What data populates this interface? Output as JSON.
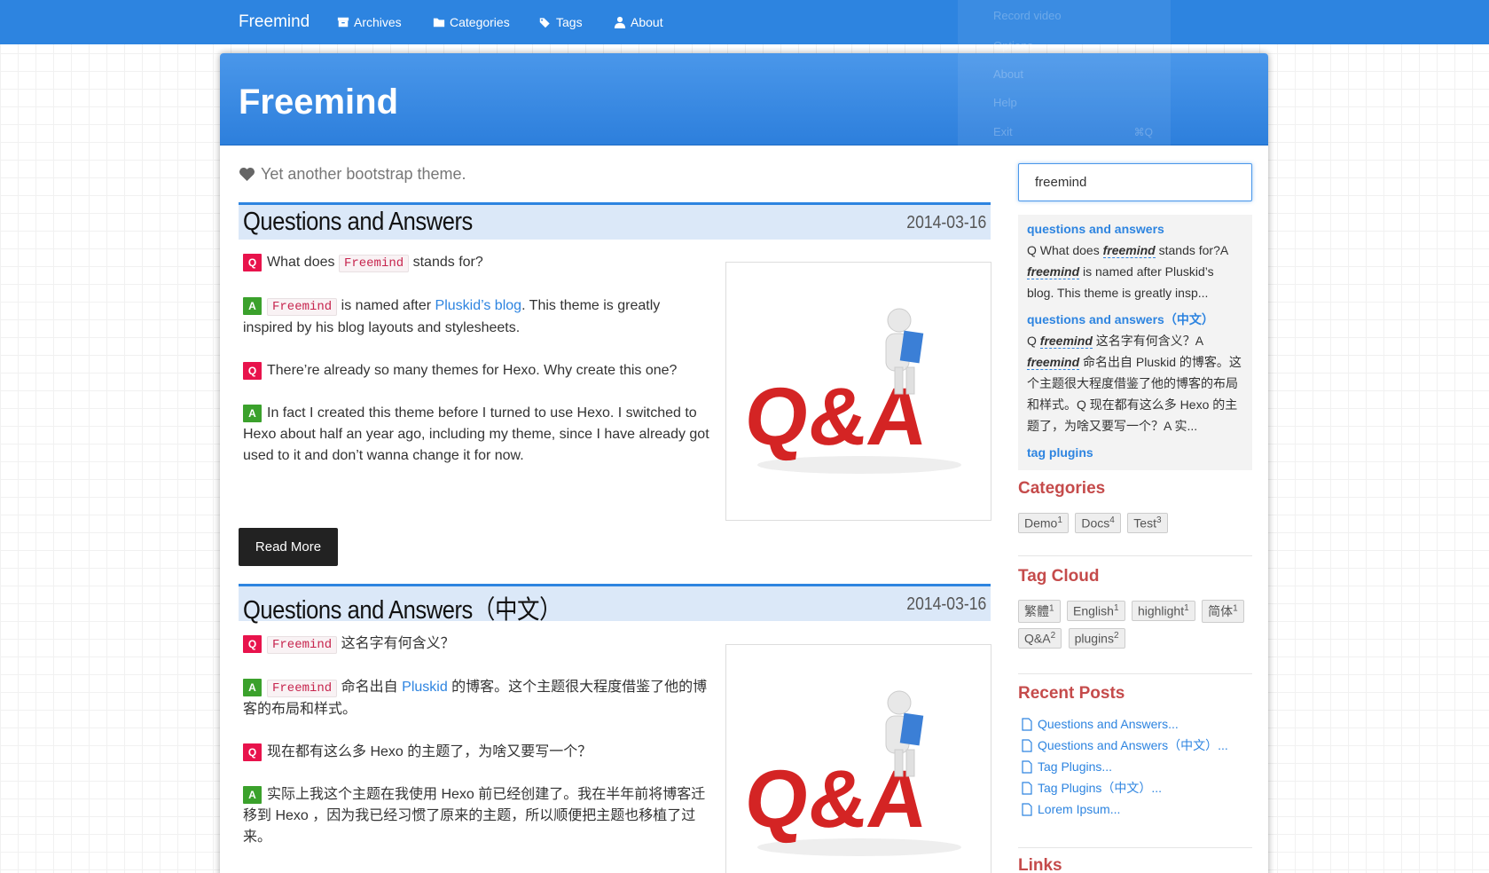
{
  "nav": {
    "brand": "Freemind",
    "items": [
      {
        "label": "Archives",
        "icon": "archive-icon"
      },
      {
        "label": "Categories",
        "icon": "folder-icon"
      },
      {
        "label": "Tags",
        "icon": "tags-icon"
      },
      {
        "label": "About",
        "icon": "user-icon"
      }
    ]
  },
  "ghost_menu": {
    "items": [
      "Record video",
      "Options",
      "About",
      "Help",
      "Exit"
    ],
    "exit_shortcut": "⌘Q"
  },
  "banner": {
    "title": "Freemind"
  },
  "tagline": "Yet another bootstrap theme.",
  "posts": [
    {
      "title": "Questions and Answers",
      "date": "2014-03-16",
      "q1_pre": "What does",
      "q1_code": "Freemind",
      "q1_post": "stands for?",
      "a1_code": "Freemind",
      "a1_pre": "is named after",
      "a1_link": "Pluskid’s blog",
      "a1_post": ". This theme is greatly inspired by his blog layouts and stylesheets.",
      "q2": "There’re already so many themes for Hexo. Why create this one?",
      "a2": "In fact I created this theme before I turned to use Hexo. I switched to Hexo about half an year ago, including my theme, since I have already got used to it and don’t wanna change it for now.",
      "read_more": "Read More"
    },
    {
      "title": "Questions and Answers（中文）",
      "date": "2014-03-16",
      "q1_code": "Freemind",
      "q1_post": "这名字有何含义？",
      "a1_code": "Freemind",
      "a1_pre": "命名出自",
      "a1_link": "Pluskid",
      "a1_post": "的博客。这个主题很大程度借鉴了他的博客的布局和样式。",
      "q2": "现在都有这么多 Hexo 的主题了，为啥又要写一个？",
      "a2": "实际上我这个主题在我使用 Hexo 前已经创建了。我在半年前将博客迁移到 Hexo ，因为我已经习惯了原来的主题，所以顺便把主题也移植了过来。"
    }
  ],
  "search": {
    "value": "freemind"
  },
  "results": [
    {
      "title": "questions and answers",
      "b1": "Q What does ",
      "em1": "freemind",
      "b2": " stands for?A ",
      "em2": "freemind",
      "b3": " is named after Pluskid’s blog. This theme is greatly insp..."
    },
    {
      "title": "questions and answers（中文）",
      "b1": "Q ",
      "em1": "freemind",
      "b2": " 这名字有何含义？A ",
      "em2": "freemind",
      "b3": " 命名出自 Pluskid 的博客。这个主题很大程度借鉴了他的博客的布局和样式。Q 现在都有这么多 Hexo 的主题了，为啥又要写一个？A 实..."
    },
    {
      "title": "tag plugins"
    }
  ],
  "categories": {
    "heading": "Categories",
    "items": [
      {
        "name": "Demo",
        "count": "1"
      },
      {
        "name": "Docs",
        "count": "4"
      },
      {
        "name": "Test",
        "count": "3"
      }
    ]
  },
  "tag_cloud": {
    "heading": "Tag Cloud",
    "items": [
      {
        "name": "繁體",
        "count": "1"
      },
      {
        "name": "English",
        "count": "1"
      },
      {
        "name": "highlight",
        "count": "1"
      },
      {
        "name": "简体",
        "count": "1"
      },
      {
        "name": "Q&A",
        "count": "2"
      },
      {
        "name": "plugins",
        "count": "2"
      }
    ]
  },
  "recent_posts": {
    "heading": "Recent Posts",
    "items": [
      "Questions and Answers...",
      "Questions and Answers（中文）...",
      "Tag Plugins...",
      "Tag Plugins（中文）...",
      "Lorem Ipsum..."
    ]
  },
  "links": {
    "heading": "Links"
  },
  "image": {
    "text": "Q&A"
  },
  "colors": {
    "accent": "#2d84e0",
    "q_badge": "#e8134c",
    "a_badge": "#3ba12c",
    "sidebar_heading": "#c54b4b"
  }
}
